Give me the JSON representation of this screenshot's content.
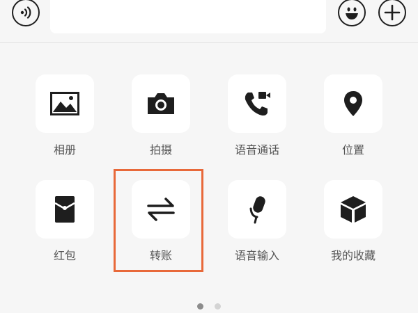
{
  "input_bar": {
    "voice_icon": "voice-wave-icon",
    "emoji_icon": "smiley-icon",
    "plus_icon": "plus-icon",
    "text_value": ""
  },
  "grid": {
    "row1": [
      {
        "label": "相册",
        "icon": "image-icon"
      },
      {
        "label": "拍摄",
        "icon": "camera-icon"
      },
      {
        "label": "语音通话",
        "icon": "video-call-icon"
      },
      {
        "label": "位置",
        "icon": "location-pin-icon"
      }
    ],
    "row2": [
      {
        "label": "红包",
        "icon": "red-packet-icon"
      },
      {
        "label": "转账",
        "icon": "transfer-icon"
      },
      {
        "label": "语音输入",
        "icon": "microphone-icon"
      },
      {
        "label": "我的收藏",
        "icon": "cube-icon"
      }
    ]
  },
  "highlighted_item": "转账",
  "pager": {
    "current_page": 1,
    "total_pages": 2
  },
  "colors": {
    "highlight": "#e8693a",
    "icon": "#1e1e1e",
    "label": "#555555",
    "dot_active": "#8c8c8c",
    "dot_inactive": "#d4d4d4"
  }
}
